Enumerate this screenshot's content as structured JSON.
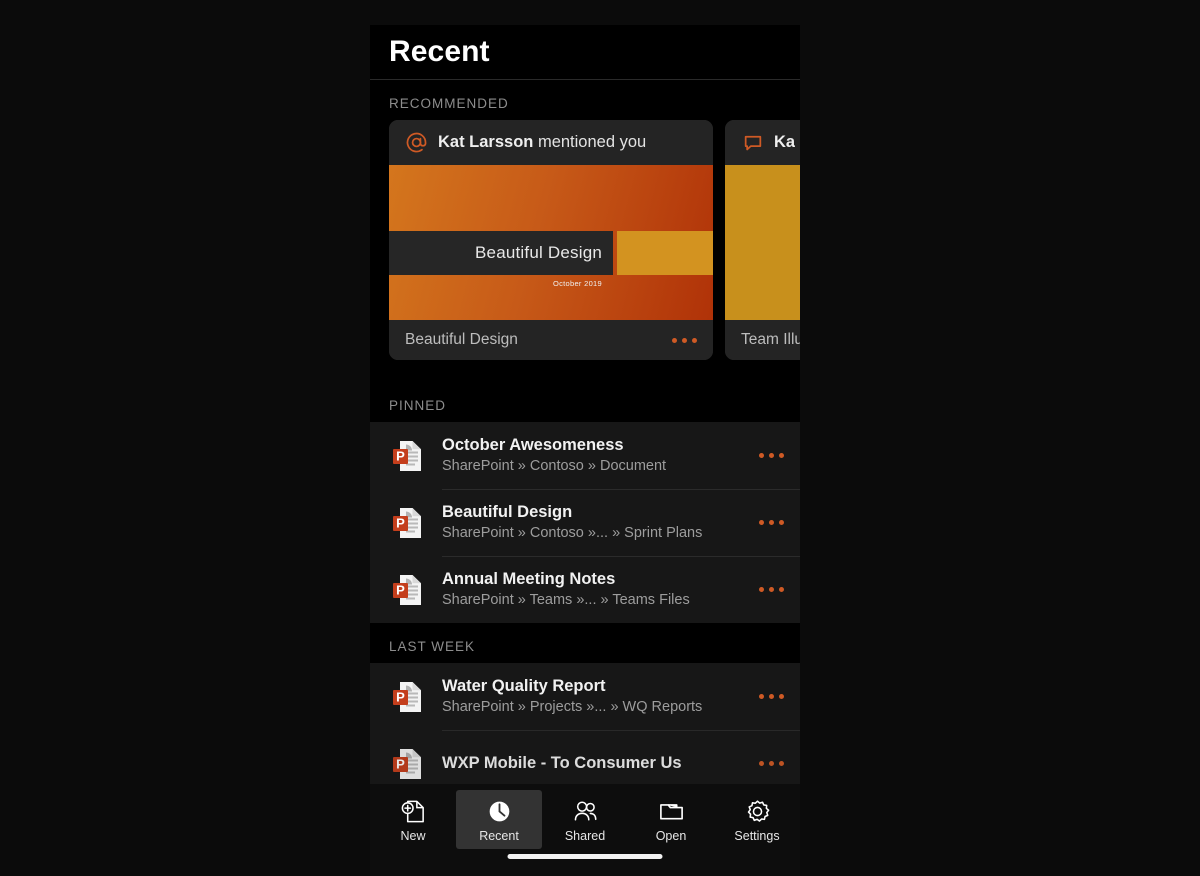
{
  "app": {
    "title": "Recent"
  },
  "sections": {
    "recommended_label": "RECOMMENDED",
    "pinned_label": "PINNED",
    "last_week_label": "LAST WEEK"
  },
  "recommended_cards": [
    {
      "icon": "at-mention-icon",
      "header_name": "Kat Larsson",
      "header_action": " mentioned you",
      "thumb_title": "Beautiful Design",
      "thumb_date": "October 2019",
      "file_name": "Beautiful Design",
      "more_label": "More actions"
    },
    {
      "icon": "comment-bubble-icon",
      "header_name": "Ka",
      "header_action": "",
      "thumb_title": "",
      "thumb_date": "",
      "file_name": "Team Illu",
      "more_label": "More actions"
    }
  ],
  "pinned_files": [
    {
      "icon": "powerpoint-file-icon",
      "name": "October Awesomeness",
      "path": "SharePoint » Contoso » Document"
    },
    {
      "icon": "powerpoint-file-icon",
      "name": "Beautiful Design",
      "path": "SharePoint » Contoso »... » Sprint Plans"
    },
    {
      "icon": "powerpoint-file-icon",
      "name": "Annual Meeting Notes",
      "path": "SharePoint » Teams »... » Teams Files"
    }
  ],
  "last_week_files": [
    {
      "icon": "powerpoint-file-icon",
      "name": "Water Quality Report",
      "path": "SharePoint » Projects »... » WQ Reports"
    },
    {
      "icon": "powerpoint-file-icon",
      "name": "WXP Mobile - To Consumer Us",
      "path": ""
    }
  ],
  "tabs": [
    {
      "icon": "new-document-icon",
      "label": "New",
      "active": false
    },
    {
      "icon": "clock-icon",
      "label": "Recent",
      "active": true
    },
    {
      "icon": "people-icon",
      "label": "Shared",
      "active": false
    },
    {
      "icon": "folder-icon",
      "label": "Open",
      "active": false
    },
    {
      "icon": "gear-icon",
      "label": "Settings",
      "active": false
    }
  ],
  "colors": {
    "accent_orange": "#cf5a25",
    "gold": "#c8901c",
    "powerpoint_red": "#c43e1c",
    "background": "#000000",
    "row_background": "#171717",
    "card_background": "#242424"
  }
}
